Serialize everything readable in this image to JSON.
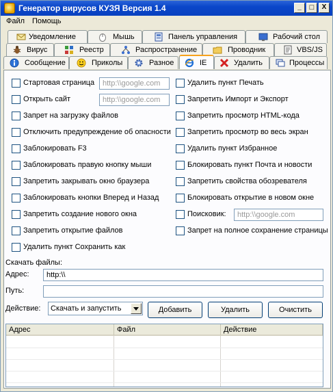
{
  "window": {
    "title": "Генератор вирусов КУЗЯ Версия 1.4",
    "controls": {
      "minimize": "_",
      "maximize": "□",
      "close": "X"
    }
  },
  "menu": {
    "file": "Файл",
    "help": "Помощь"
  },
  "tabs": {
    "row1": [
      {
        "label": "Уведомление",
        "icon": "envelope-icon"
      },
      {
        "label": "Мышь",
        "icon": "mouse-icon"
      },
      {
        "label": "Панель управления",
        "icon": "control-panel-icon"
      },
      {
        "label": "Рабочий стол",
        "icon": "desktop-icon"
      }
    ],
    "row2": [
      {
        "label": "Вирус",
        "icon": "bug-icon"
      },
      {
        "label": "Реестр",
        "icon": "registry-icon"
      },
      {
        "label": "Распространение",
        "icon": "network-icon"
      },
      {
        "label": "Проводник",
        "icon": "folder-icon"
      },
      {
        "label": "VBS/JS",
        "icon": "script-icon"
      }
    ],
    "row3": [
      {
        "label": "Сообщение",
        "icon": "info-icon"
      },
      {
        "label": "Приколы",
        "icon": "smiley-icon"
      },
      {
        "label": "Разное",
        "icon": "gear-icon"
      },
      {
        "label": "IE",
        "icon": "ie-icon"
      },
      {
        "label": "Удалить",
        "icon": "delete-icon"
      },
      {
        "label": "Процессы",
        "icon": "processes-icon"
      }
    ],
    "active": "IE"
  },
  "options": {
    "left": [
      "Стартовая страница",
      "Открыть сайт",
      "Запрет на загрузку файлов",
      "Отключить предупреждение об опасности",
      "Заблокировать F3",
      "Заблокировать правую кнопку мыши",
      "Запретить закрывать окно браузера",
      "Заблокировать кнопки Вперед и Назад",
      "Запретить создание нового окна",
      "Запретить открытие файлов",
      "Удалить пункт Сохранить как"
    ],
    "right": [
      "Удалить пункт Печать",
      "Запретить Импорт и Экспорт",
      "Запретить просмотр HTML-кода",
      "Запретить просмотр во весь экран",
      "Удалить пункт Избранное",
      "Блокировать пункт Почта и новости",
      "Запретить свойства обозревателя",
      "Блокировать открытие в новом окне",
      "Поисковик:",
      "Запрет на полное сохранение страницы"
    ],
    "start_page_placeholder": "http:\\\\google.com",
    "open_site_placeholder": "http:\\\\google.com",
    "search_placeholder": "http:\\\\google.com"
  },
  "download": {
    "section_label": "Скачать файлы:",
    "address_label": "Адрес:",
    "address_value": "http:\\\\",
    "path_label": "Путь:",
    "path_value": "",
    "action_label": "Действие:",
    "action_value": "Скачать и запустить",
    "add_button": "Добавить",
    "delete_button": "Удалить",
    "clear_button": "Очистить"
  },
  "table": {
    "columns": [
      "Адрес",
      "Файл",
      "Действие"
    ],
    "rows": []
  }
}
